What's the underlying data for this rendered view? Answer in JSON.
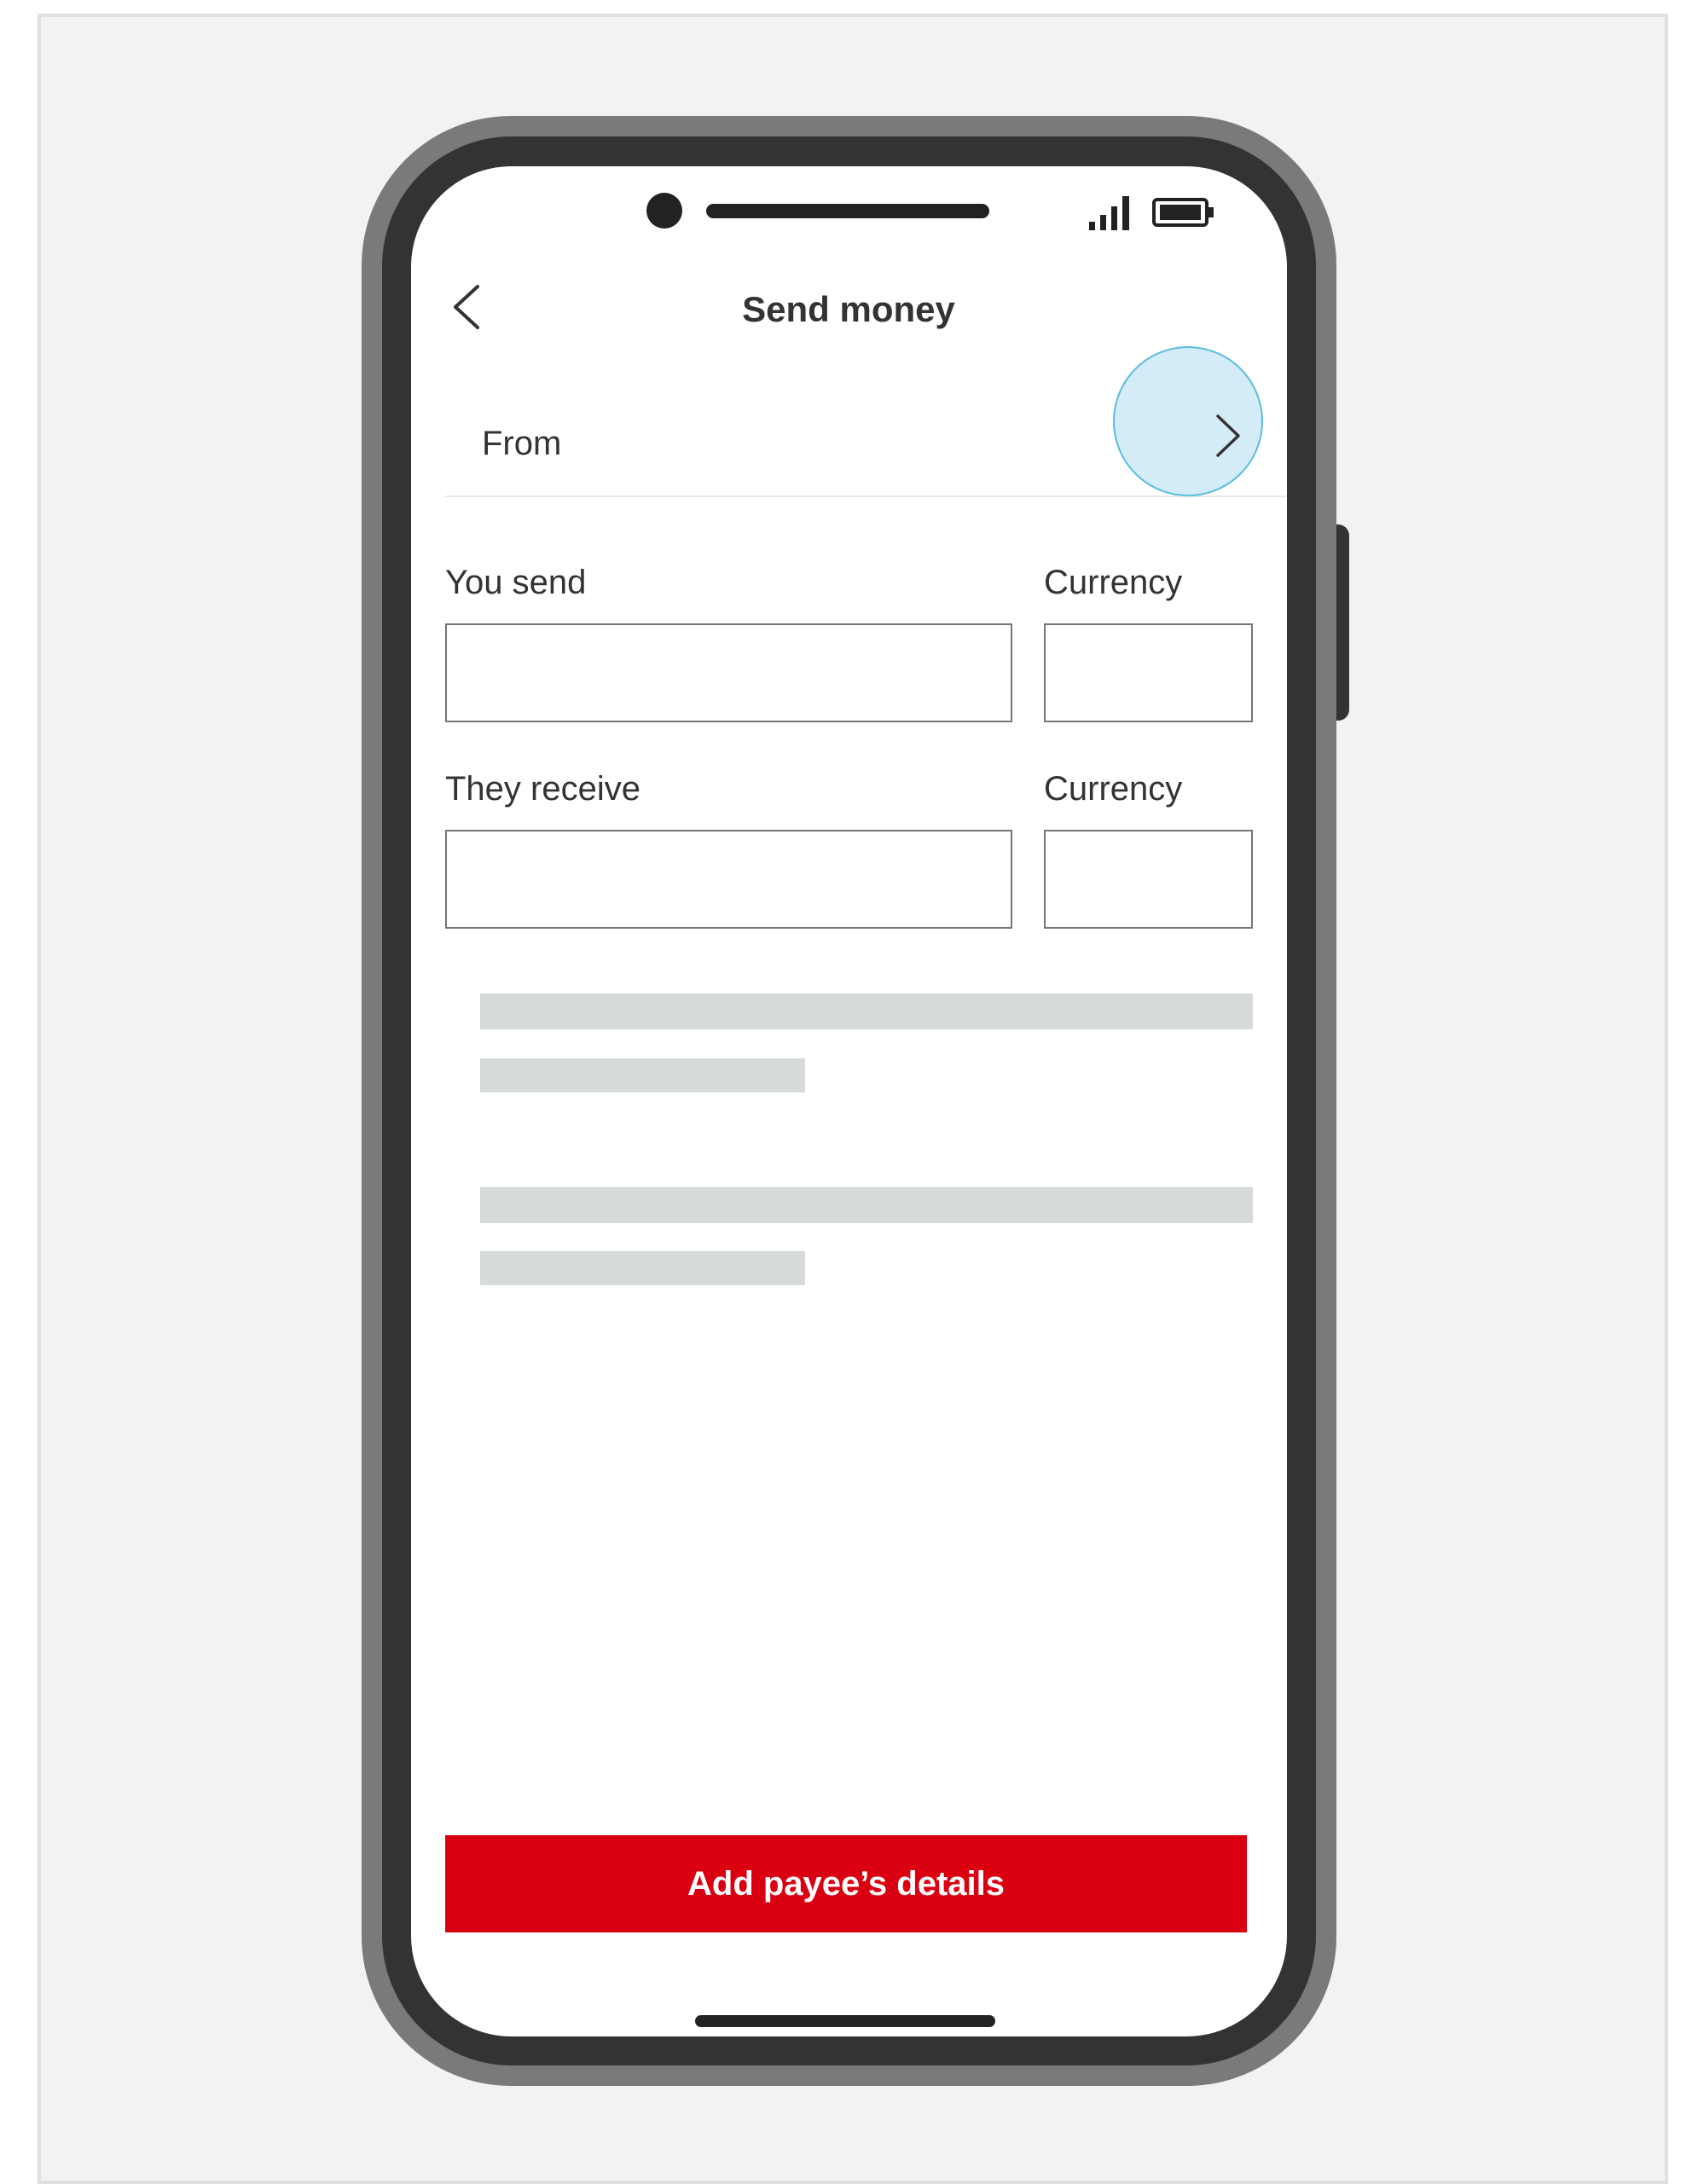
{
  "header": {
    "title": "Send money",
    "back_icon": "chevron-left-icon"
  },
  "from_row": {
    "label": "From",
    "chevron_icon": "chevron-right-icon"
  },
  "send_section": {
    "amount_label": "You send",
    "amount_value": "",
    "currency_label": "Currency",
    "currency_value": ""
  },
  "receive_section": {
    "amount_label": "They receive",
    "amount_value": "",
    "currency_label": "Currency",
    "currency_value": ""
  },
  "primary_action": {
    "label": "Add payee’s details"
  },
  "colors": {
    "brand_red": "#db0011",
    "tap_highlight": "#a0d4f0",
    "skeleton": "#d7dadb",
    "text": "#333333",
    "background": "#f2f2f2"
  }
}
